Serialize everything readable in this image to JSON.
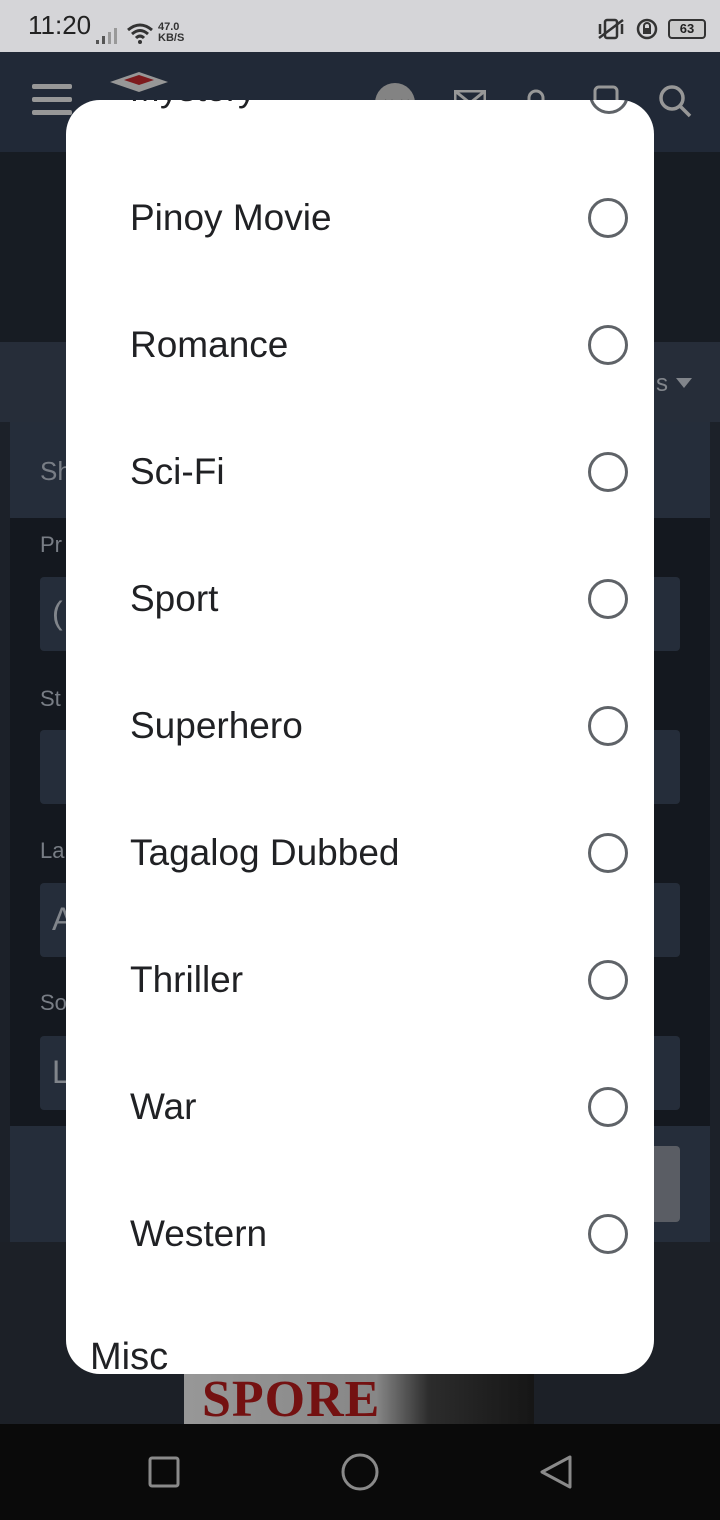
{
  "status_bar": {
    "time": "11:20",
    "net_speed_value": "47.0",
    "net_speed_unit": "KB/S",
    "battery": "63"
  },
  "background": {
    "labels": [
      "Sh",
      "Pr",
      "St",
      "La",
      "So"
    ],
    "field_prefixes": [
      "(",
      "A",
      "L"
    ],
    "sort_suffix": "s",
    "poster_title": "SPORE"
  },
  "dialog": {
    "partial_top_label": "Mystery",
    "options": [
      {
        "label": "Pinoy Movie",
        "selected": false
      },
      {
        "label": "Romance",
        "selected": false
      },
      {
        "label": "Sci-Fi",
        "selected": false
      },
      {
        "label": "Sport",
        "selected": false
      },
      {
        "label": "Superhero",
        "selected": false
      },
      {
        "label": "Tagalog Dubbed",
        "selected": false
      },
      {
        "label": "Thriller",
        "selected": false
      },
      {
        "label": "War",
        "selected": false
      },
      {
        "label": "Western",
        "selected": false
      }
    ],
    "next_section_header": "Misc"
  },
  "navbar": {
    "icons": [
      "recent-apps-icon",
      "home-icon",
      "back-icon"
    ]
  }
}
